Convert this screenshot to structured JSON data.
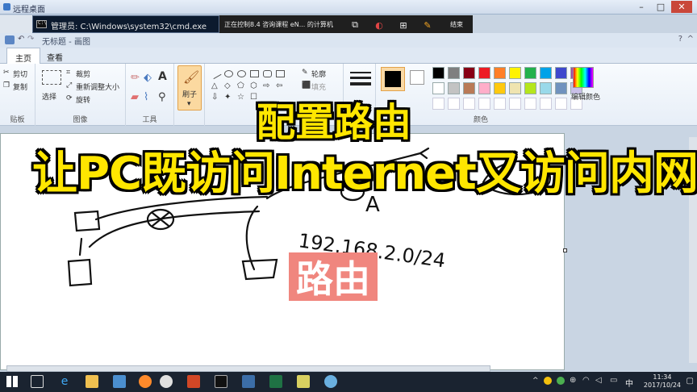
{
  "remote_desktop": {
    "title": "远程桌面"
  },
  "cmd_window": {
    "title": "管理员: C:\\Windows\\system32\\cmd.exe"
  },
  "share_bar": {
    "status": "正在控制8.4 咨询课程 eN... 的计算机",
    "end_label": "结束"
  },
  "paint_window": {
    "title": "无标题 - 画图"
  },
  "ribbon": {
    "tabs": [
      "主页",
      "查看"
    ],
    "clipboard": {
      "cut": "剪切",
      "copy": "复制",
      "paste_group": "贴板"
    },
    "image": {
      "select": "选择",
      "crop": "裁剪",
      "resize": "重新调整大小",
      "rotate": "旋转",
      "group": "图像"
    },
    "tools": {
      "group": "工具"
    },
    "brush": {
      "label": "刷子"
    },
    "shapes": {
      "outline": "轮廓",
      "fill": "填充"
    },
    "colors": {
      "group": "颜色",
      "edit": "编辑颜色"
    }
  },
  "palette": {
    "row1": [
      "#000000",
      "#7f7f7f",
      "#880015",
      "#ed1c24",
      "#ff7f27",
      "#fff200",
      "#22b14c",
      "#00a2e8",
      "#3f48cc",
      "#a349a4"
    ],
    "row2": [
      "#ffffff",
      "#c3c3c3",
      "#b97a57",
      "#ffaec9",
      "#ffc90e",
      "#efe4b0",
      "#b5e61d",
      "#99d9ea",
      "#7092be",
      "#c8bfe7"
    ]
  },
  "canvas": {
    "handwriting": "192.168.2.0/24",
    "letter_a": "A"
  },
  "overlay": {
    "title_line1": "配置路由",
    "title_line2": "让PC既访问Internet又访问内网",
    "stamp": "路由"
  },
  "tray": {
    "ime": "中",
    "time": "11:34",
    "date": "2017/10/24"
  }
}
